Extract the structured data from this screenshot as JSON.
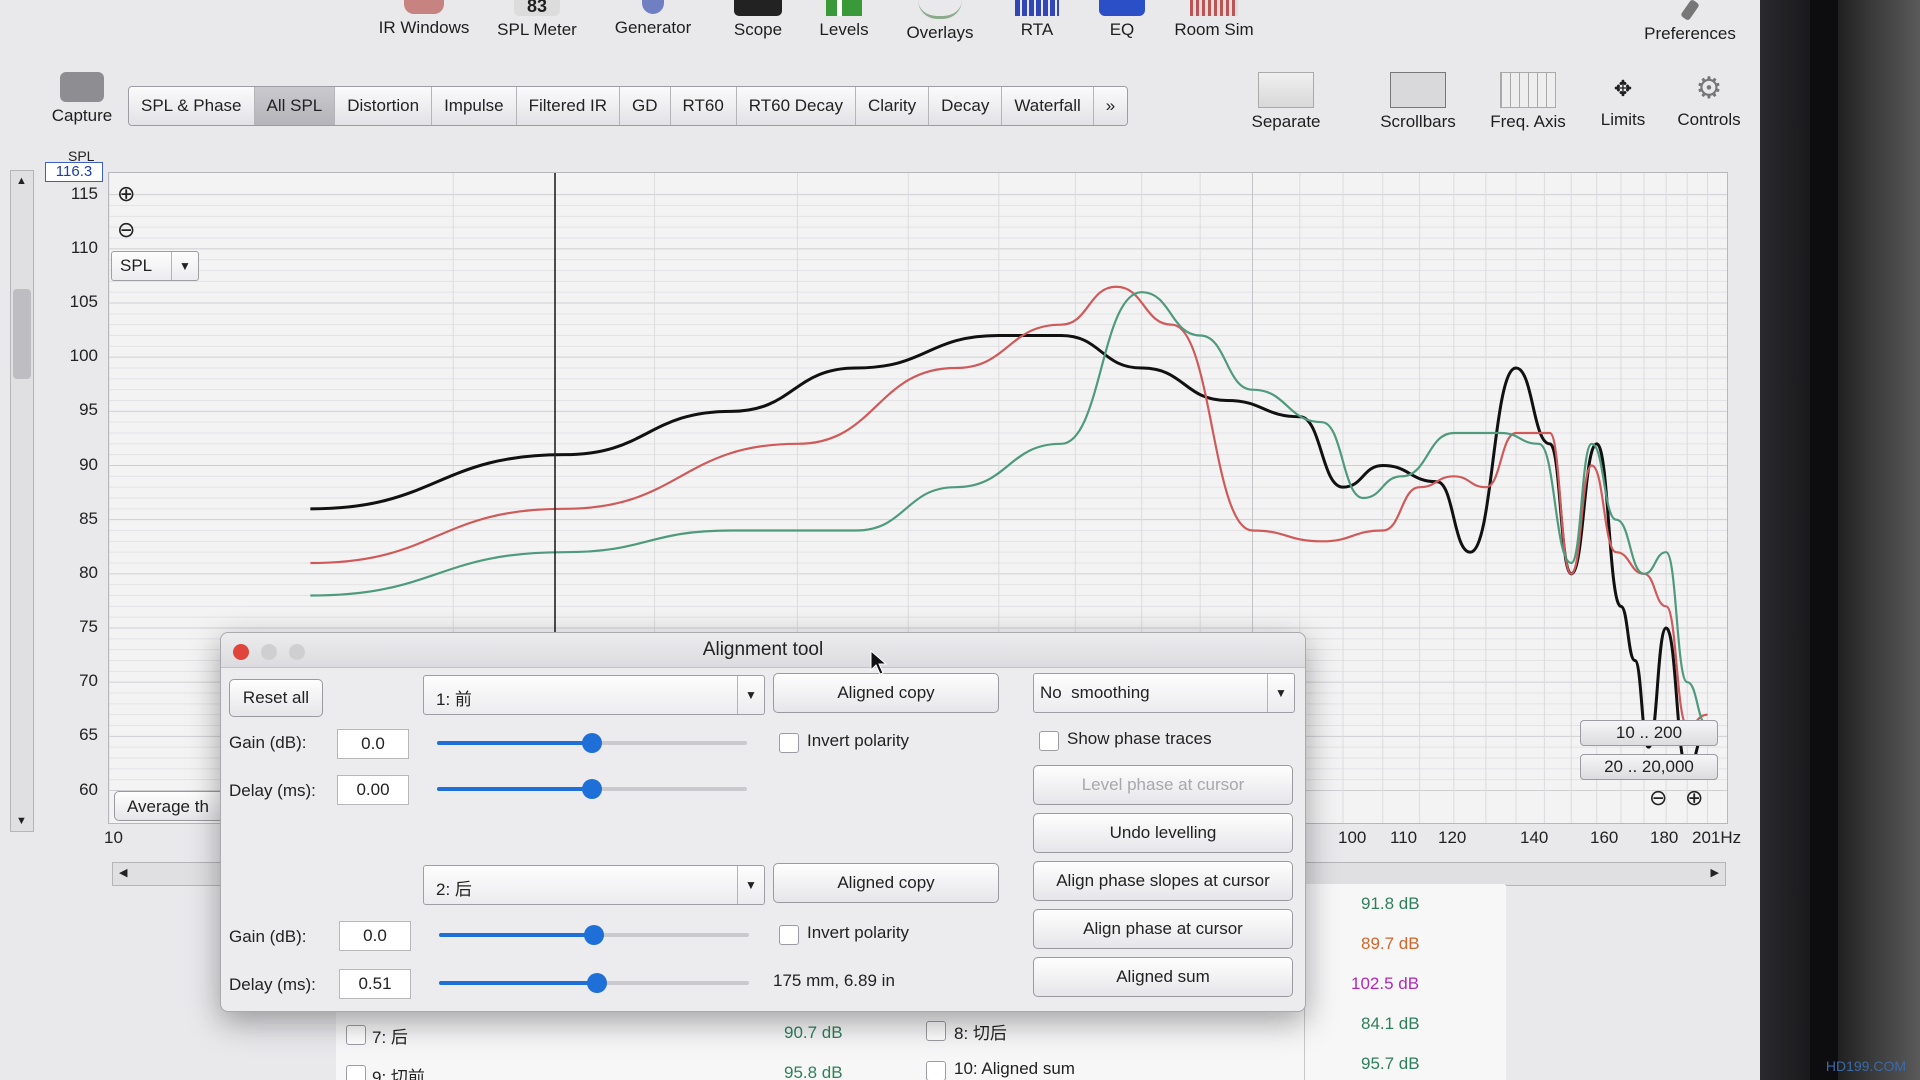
{
  "toolbar": {
    "items": [
      "IR Windows",
      "SPL Meter",
      "Generator",
      "Scope",
      "Levels",
      "Overlays",
      "RTA",
      "EQ",
      "Room Sim"
    ],
    "spl_meter_value": "83",
    "preferences": "Preferences",
    "capture": "Capture"
  },
  "tabs": [
    "SPL & Phase",
    "All SPL",
    "Distortion",
    "Impulse",
    "Filtered IR",
    "GD",
    "RT60",
    "RT60 Decay",
    "Clarity",
    "Decay",
    "Waterfall",
    "»"
  ],
  "active_tab": "All SPL",
  "view_tools": [
    "Separate",
    "Scrollbars",
    "Freq. Axis",
    "Limits",
    "Controls"
  ],
  "plot": {
    "y_axis_title": "SPL",
    "cursor_readout": "116.3",
    "y_ticks": [
      "115",
      "110",
      "105",
      "100",
      "95",
      "90",
      "85",
      "80",
      "75",
      "70",
      "65",
      "60"
    ],
    "x_ticks": [
      "10",
      "100",
      "110",
      "120",
      "140",
      "160",
      "180",
      "201Hz"
    ],
    "mode_select": "SPL",
    "average_button": "Average th",
    "range_buttons": [
      "10 .. 200",
      "20 .. 20,000"
    ]
  },
  "chart_data": {
    "type": "line",
    "ylim": [
      57,
      117
    ],
    "xscale": "log",
    "grid": true,
    "series": [
      {
        "color": "#111111",
        "points": [
          [
            15,
            86
          ],
          [
            25,
            91
          ],
          [
            35,
            95
          ],
          [
            45,
            99
          ],
          [
            60,
            102
          ],
          [
            68,
            102
          ],
          [
            80,
            99
          ],
          [
            95,
            96
          ],
          [
            110,
            94.5
          ],
          [
            120,
            88
          ],
          [
            130,
            90
          ],
          [
            145,
            88.5
          ],
          [
            155,
            82
          ],
          [
            170,
            99
          ],
          [
            182,
            92
          ],
          [
            190,
            80
          ],
          [
            200,
            92
          ],
          [
            210,
            77
          ],
          [
            216,
            72
          ],
          [
            222,
            64
          ],
          [
            230,
            75
          ],
          [
            240,
            62
          ],
          [
            250,
            66
          ]
        ]
      },
      {
        "color": "#d05a5a",
        "points": [
          [
            15,
            81
          ],
          [
            25,
            86
          ],
          [
            40,
            92
          ],
          [
            55,
            99
          ],
          [
            68,
            103
          ],
          [
            76,
            106.5
          ],
          [
            85,
            103
          ],
          [
            100,
            84
          ],
          [
            115,
            83
          ],
          [
            130,
            84
          ],
          [
            140,
            88
          ],
          [
            150,
            89
          ],
          [
            160,
            88
          ],
          [
            170,
            93
          ],
          [
            182,
            93
          ],
          [
            190,
            80
          ],
          [
            198,
            90
          ],
          [
            208,
            82
          ],
          [
            220,
            80
          ],
          [
            230,
            77
          ],
          [
            240,
            66
          ],
          [
            250,
            67
          ]
        ]
      },
      {
        "color": "#4f9a7c",
        "points": [
          [
            15,
            78
          ],
          [
            25,
            82
          ],
          [
            35,
            84
          ],
          [
            45,
            84
          ],
          [
            55,
            88
          ],
          [
            68,
            92
          ],
          [
            80,
            106
          ],
          [
            90,
            102
          ],
          [
            100,
            97
          ],
          [
            115,
            94
          ],
          [
            125,
            87
          ],
          [
            135,
            89
          ],
          [
            150,
            93
          ],
          [
            165,
            93
          ],
          [
            178,
            92
          ],
          [
            190,
            81
          ],
          [
            198,
            92
          ],
          [
            208,
            85
          ],
          [
            220,
            80
          ],
          [
            230,
            82
          ],
          [
            240,
            70
          ],
          [
            250,
            66
          ]
        ]
      }
    ]
  },
  "dialog": {
    "title": "Alignment tool",
    "reset_all": "Reset all",
    "gain_label": "Gain (dB):",
    "delay_label": "Delay (ms):",
    "meas1": {
      "select": "1: 前",
      "gain": "0.0",
      "delay": "0.00",
      "gain_slider": 0.5,
      "delay_slider": 0.5
    },
    "meas2": {
      "select": "2: 后",
      "gain": "0.0",
      "delay": "0.51",
      "gain_slider": 0.5,
      "delay_slider": 0.51
    },
    "aligned_copy": "Aligned copy",
    "invert_polarity": "Invert polarity",
    "distance_readout": "175 mm, 6.89 in",
    "smoothing": "No  smoothing",
    "show_phase_traces": "Show phase traces",
    "level_phase": "Level phase at cursor",
    "undo_levelling": "Undo levelling",
    "align_slopes": "Align phase slopes at cursor",
    "align_phase": "Align phase at cursor",
    "aligned_sum": "Aligned sum"
  },
  "measurements": {
    "right_values": [
      {
        "value": "91.8 dB",
        "color": "#2f7f5c"
      },
      {
        "value": "89.7 dB",
        "color": "#d0662a"
      },
      {
        "value": "102.5 dB",
        "color": "#b02ab8"
      },
      {
        "value": "84.1 dB",
        "color": "#2f7f5c"
      },
      {
        "value": "95.7 dB",
        "color": "#2f7f5c"
      }
    ],
    "rows": [
      {
        "name": "7: 后",
        "value": "90.7 dB"
      },
      {
        "name": "9: 切前",
        "value": "95.8 dB"
      }
    ],
    "mid_rows": [
      "8: 切后",
      "10: Aligned sum"
    ]
  },
  "watermark": "HD199.COM"
}
